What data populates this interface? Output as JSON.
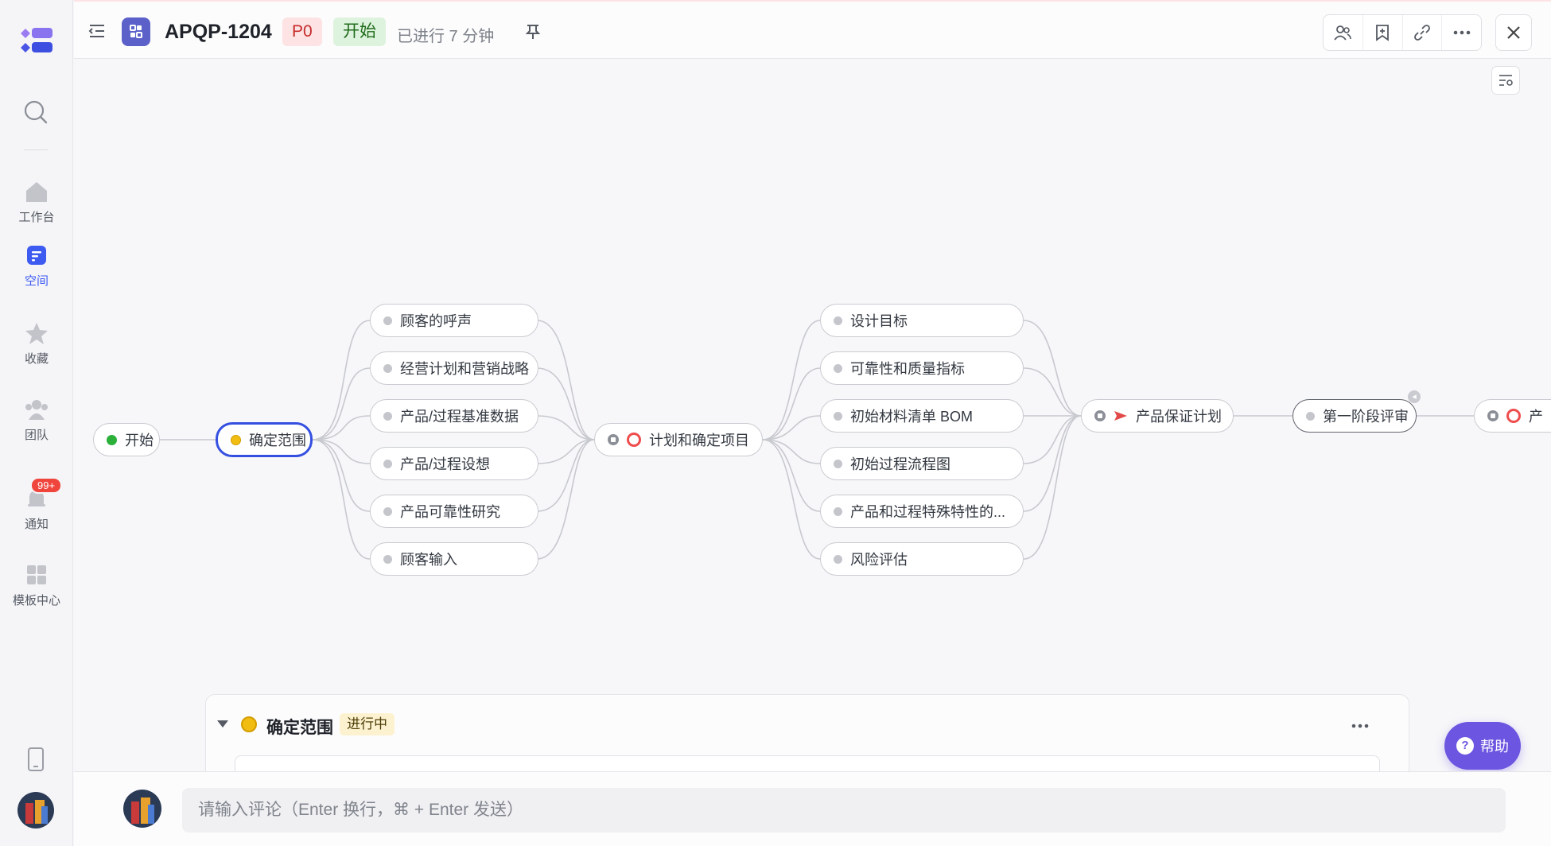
{
  "header": {
    "task_id": "APQP-1204",
    "priority": "P0",
    "status": "开始",
    "elapsed": "已进行 7 分钟"
  },
  "sidebar": {
    "items": [
      {
        "label": "工作台",
        "icon": "home-icon"
      },
      {
        "label": "空间",
        "icon": "space-icon"
      },
      {
        "label": "收藏",
        "icon": "star-icon"
      },
      {
        "label": "团队",
        "icon": "team-icon"
      },
      {
        "label": "通知",
        "icon": "bell-icon",
        "badge": "99+"
      },
      {
        "label": "模板中心",
        "icon": "template-icon"
      }
    ]
  },
  "flow": {
    "start": "开始",
    "scope": "确定范围",
    "scope_children": [
      "顾客的呼声",
      "经营计划和营销战略",
      "产品/过程基准数据",
      "产品/过程设想",
      "产品可靠性研究",
      "顾客输入"
    ],
    "plan": "计划和确定项目",
    "plan_children": [
      "设计目标",
      "可靠性和质量指标",
      "初始材料清单 BOM",
      "初始过程流程图",
      "产品和过程特殊特性的...",
      "风险评估"
    ],
    "assurance": "产品保证计划",
    "review": "第一阶段评审",
    "next": "产"
  },
  "panel": {
    "title": "确定范围",
    "status": "进行中"
  },
  "help": {
    "label": "帮助"
  },
  "comment": {
    "placeholder": "请输入评论（Enter 换行，⌘ + Enter 发送）"
  },
  "colors": {
    "accent": "#3d5af1",
    "selected_border": "#3550e0",
    "help": "#6c55e0"
  }
}
